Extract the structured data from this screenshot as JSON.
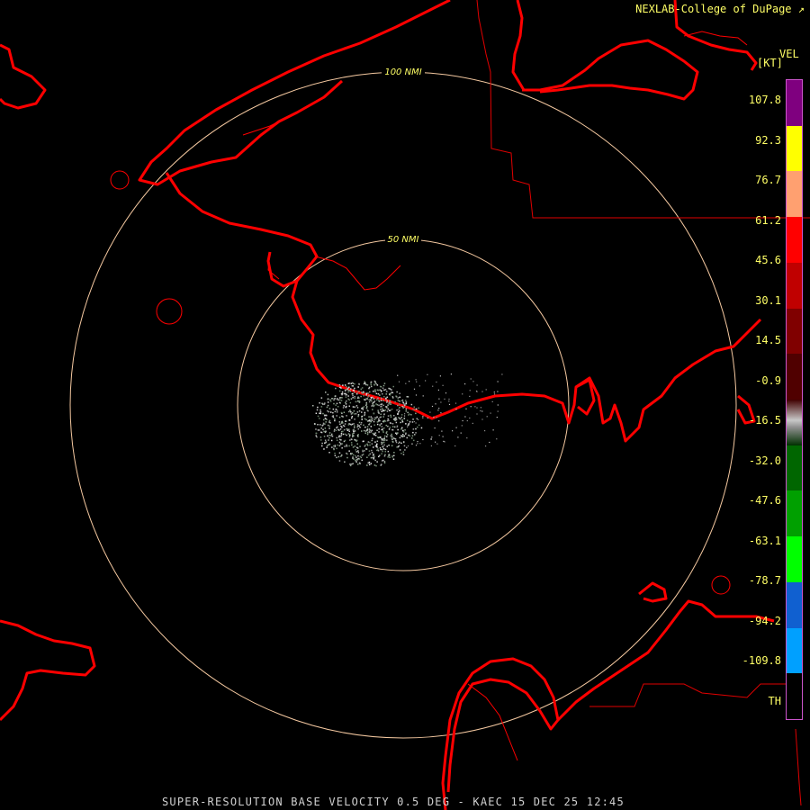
{
  "credit": "NEXLAB-College of DuPage",
  "product_line": "SUPER-RESOLUTION BASE VELOCITY 0.5 DEG - KAEC 15 DEC 25 12:45",
  "rings": [
    {
      "label": "100 NMI"
    },
    {
      "label": "50 NMI"
    }
  ],
  "legend": {
    "title": "VEL",
    "unit": "[KT]",
    "ticks": [
      "107.8",
      "92.3",
      "76.7",
      "61.2",
      "45.6",
      "30.1",
      "14.5",
      "-0.9",
      "-16.5",
      "-32.0",
      "-47.6",
      "-63.1",
      "-78.7",
      "-94.2",
      "-109.8",
      "TH"
    ],
    "colors": [
      "#7f007f",
      "#ffff00",
      "#ffa070",
      "#ff0000",
      "#c00000",
      "#800000",
      "#500000",
      "#a0a0a0",
      "#006600",
      "#00a000",
      "#00ff00",
      "#1060d0",
      "#00a0ff",
      "#000000"
    ]
  },
  "colors": {
    "coast": "#ff0000",
    "ring": "#f4c8a0",
    "label": "#ffff66"
  },
  "icons": [
    "link-arrow-icon"
  ]
}
